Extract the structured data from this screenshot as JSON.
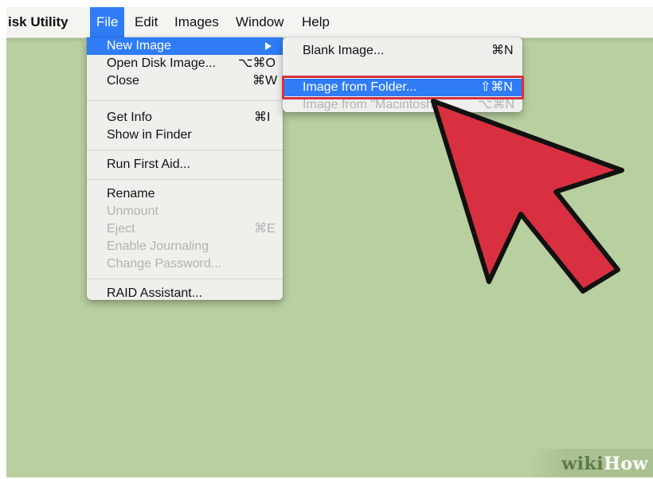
{
  "menubar": {
    "app_name": "isk Utility",
    "items": [
      "File",
      "Edit",
      "Images",
      "Window",
      "Help"
    ]
  },
  "file_menu": {
    "items": [
      {
        "label": "New Image",
        "shortcut": "▶",
        "state": "highlighted"
      },
      {
        "label": "Open Disk Image...",
        "shortcut": "⌥⌘O",
        "state": "enabled"
      },
      {
        "label": "Close",
        "shortcut": "⌘W",
        "state": "enabled"
      },
      {
        "label": "Get Info",
        "shortcut": "⌘I",
        "state": "enabled"
      },
      {
        "label": "Show in Finder",
        "shortcut": "",
        "state": "enabled"
      },
      {
        "label": "Run First Aid...",
        "shortcut": "",
        "state": "enabled"
      },
      {
        "label": "Rename",
        "shortcut": "",
        "state": "enabled"
      },
      {
        "label": "Unmount",
        "shortcut": "",
        "state": "disabled"
      },
      {
        "label": "Eject",
        "shortcut": "⌘E",
        "state": "disabled"
      },
      {
        "label": "Enable Journaling",
        "shortcut": "",
        "state": "disabled"
      },
      {
        "label": "Change Password...",
        "shortcut": "",
        "state": "disabled"
      },
      {
        "label": "RAID Assistant...",
        "shortcut": "",
        "state": "enabled"
      }
    ]
  },
  "submenu": {
    "items": [
      {
        "label": "Blank Image...",
        "shortcut": "⌘N",
        "state": "enabled"
      },
      {
        "label": "Image from Folder...",
        "shortcut": "⇧⌘N",
        "state": "highlighted"
      },
      {
        "label": "Image from \"Macintosh\"",
        "shortcut": "⌥⌘N",
        "state": "disabled"
      }
    ]
  },
  "watermark": {
    "part1": "wiki",
    "part2": "How"
  },
  "colors": {
    "background": "#b8cfa0",
    "selection": "#2f7cf6",
    "pointer_arrow": "#d83040",
    "highlight_box": "#d83040"
  }
}
